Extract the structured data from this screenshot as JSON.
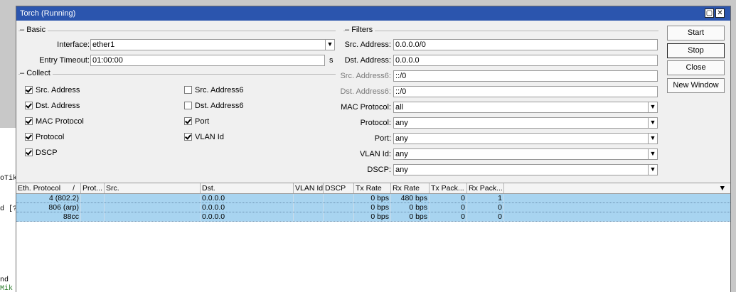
{
  "window": {
    "title": "Torch (Running)"
  },
  "background": {
    "term_lines": [
      "oTik",
      "d [?",
      "nd",
      "Mik"
    ]
  },
  "basic": {
    "group_label": "Basic",
    "interface_label": "Interface:",
    "interface_value": "ether1",
    "entry_timeout_label": "Entry Timeout:",
    "entry_timeout_value": "01:00:00",
    "entry_timeout_unit": "s"
  },
  "collect": {
    "group_label": "Collect",
    "items": [
      {
        "label": "Src. Address",
        "checked": true
      },
      {
        "label": "Dst. Address",
        "checked": true
      },
      {
        "label": "MAC Protocol",
        "checked": true
      },
      {
        "label": "Protocol",
        "checked": true
      },
      {
        "label": "DSCP",
        "checked": true
      },
      {
        "label": "Src. Address6",
        "checked": false
      },
      {
        "label": "Dst. Address6",
        "checked": false
      },
      {
        "label": "Port",
        "checked": true
      },
      {
        "label": "VLAN Id",
        "checked": true
      }
    ]
  },
  "filters": {
    "group_label": "Filters",
    "rows": [
      {
        "label": "Src. Address:",
        "value": "0.0.0.0/0",
        "dropdown": false,
        "dim": false
      },
      {
        "label": "Dst. Address:",
        "value": "0.0.0.0",
        "dropdown": false,
        "dim": false
      },
      {
        "label": "Src. Address6:",
        "value": "::/0",
        "dropdown": false,
        "dim": true
      },
      {
        "label": "Dst. Address6:",
        "value": "::/0",
        "dropdown": false,
        "dim": true
      },
      {
        "label": "MAC Protocol:",
        "value": "all",
        "dropdown": true,
        "dim": false
      },
      {
        "label": "Protocol:",
        "value": "any",
        "dropdown": true,
        "dim": false
      },
      {
        "label": "Port:",
        "value": "any",
        "dropdown": true,
        "dim": false
      },
      {
        "label": "VLAN Id:",
        "value": "any",
        "dropdown": true,
        "dim": false
      },
      {
        "label": "DSCP:",
        "value": "any",
        "dropdown": true,
        "dim": false
      }
    ]
  },
  "buttons": {
    "start": "Start",
    "stop": "Stop",
    "close": "Close",
    "new_window": "New Window"
  },
  "table": {
    "sort_indicator": "/",
    "menu_glyph": "▼",
    "columns": [
      "Eth. Protocol",
      "Prot...",
      "Src.",
      "Dst.",
      "VLAN Id",
      "DSCP",
      "Tx Rate",
      "Rx Rate",
      "Tx Pack...",
      "Rx Pack..."
    ],
    "rows": [
      [
        "4 (802.2)",
        "",
        "",
        "0.0.0.0",
        "",
        "",
        "0 bps",
        "480 bps",
        "0",
        "1"
      ],
      [
        "806 (arp)",
        "",
        "",
        "0.0.0.0",
        "",
        "",
        "0 bps",
        "0 bps",
        "0",
        "0"
      ],
      [
        "88cc",
        "",
        "",
        "0.0.0.0",
        "",
        "",
        "0 bps",
        "0 bps",
        "0",
        "0"
      ]
    ]
  }
}
